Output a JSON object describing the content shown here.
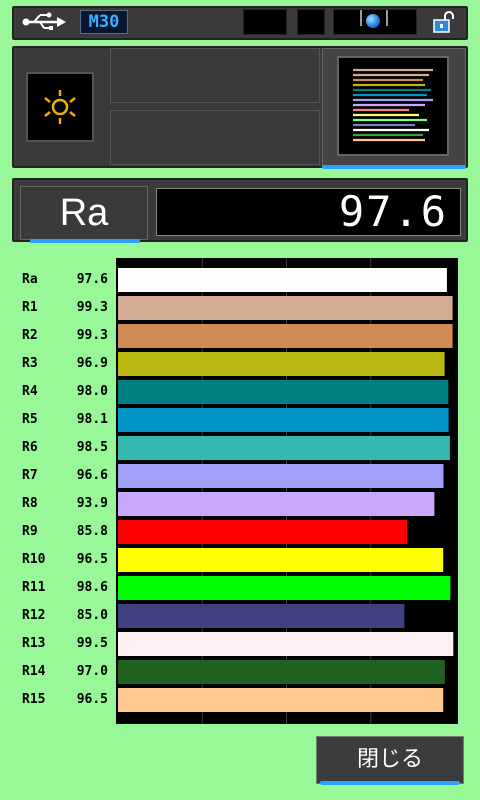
{
  "status_bar": {
    "usb_icon": "usb-icon",
    "mode_label": "M30",
    "level_icon": "level-indicator-icon",
    "lock_icon": "unlocked-padlock-icon",
    "accent_color": "#2aa0ff"
  },
  "toolbar": {
    "light_icon": "light-source-icon",
    "chart_icon": "spectrum-bars-thumbnail-icon"
  },
  "ra": {
    "label": "Ra",
    "value": "97.6"
  },
  "chart_data": {
    "type": "bar",
    "orientation": "horizontal",
    "categories": [
      "Ra",
      "R1",
      "R2",
      "R3",
      "R4",
      "R5",
      "R6",
      "R7",
      "R8",
      "R9",
      "R10",
      "R11",
      "R12",
      "R13",
      "R14",
      "R15"
    ],
    "value_labels": [
      "97.6",
      "99.3",
      "99.3",
      "96.9",
      "98.0",
      "98.1",
      "98.5",
      "96.6",
      "93.9",
      "85.8",
      "96.5",
      "98.6",
      "85.0",
      "99.5",
      "97.0",
      "96.5"
    ],
    "values": [
      97.6,
      99.3,
      99.3,
      96.9,
      98.0,
      98.1,
      98.5,
      96.6,
      93.9,
      85.8,
      96.5,
      98.6,
      85.0,
      99.5,
      97.0,
      96.5
    ],
    "colors": [
      "#ffffff",
      "#d4ac94",
      "#d08a58",
      "#bcb812",
      "#008080",
      "#0096c8",
      "#34b8b0",
      "#a0a0f8",
      "#c8a8f8",
      "#ff0000",
      "#ffff00",
      "#00ff00",
      "#404080",
      "#fff0f4",
      "#206020",
      "#ffc890"
    ],
    "xlim": [
      0,
      100
    ],
    "grid": true
  },
  "close_button": {
    "label": "閉じる"
  }
}
